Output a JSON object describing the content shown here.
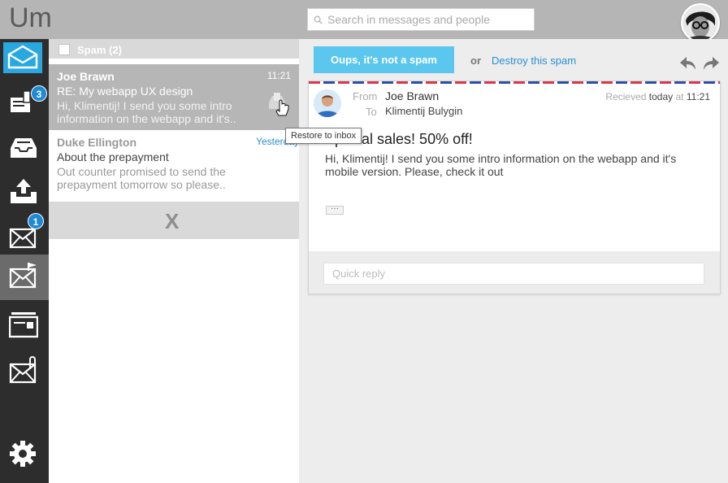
{
  "app": {
    "logo": "Um"
  },
  "search": {
    "placeholder": "Search in messages and people"
  },
  "rail": {
    "badges": {
      "notes": "3",
      "incoming": "1"
    }
  },
  "list": {
    "header_label": "Spam (2)",
    "messages": [
      {
        "from": "Joe Brawn",
        "time": "11:21",
        "subject": "RE: My webapp UX design",
        "preview": "Hi, Klimentij! I send you some intro information on the webapp and it's.."
      },
      {
        "from": "Duke Ellington",
        "time": "Yesterday",
        "subject": "About the prepayment",
        "preview": "Out counter promised to send the prepayment tomorrow so please.."
      }
    ],
    "tooltip": "Restore to inbox",
    "close_label": "X"
  },
  "actions": {
    "not_spam": "Oups, it's not a spam",
    "or": "or",
    "destroy": "Destroy this spam"
  },
  "mail": {
    "from_label": "From",
    "from": "Joe Brawn",
    "to_label": "To",
    "to": "Klimentij Bulygin",
    "received_label": "Recieved",
    "received_day": "today",
    "received_at": "at",
    "received_time": "11:21",
    "subject": "Special sales! 50% off!",
    "body": "Hi, Klimentij! I send you some intro information on the webapp and it's mobile version. Please, check it out",
    "more": "···",
    "reply_placeholder": "Quick reply"
  },
  "colors": {
    "accent": "#29a8e0",
    "badge": "#1e8ad6",
    "link": "#2a8ed3",
    "rail": "#2d2d2d"
  }
}
